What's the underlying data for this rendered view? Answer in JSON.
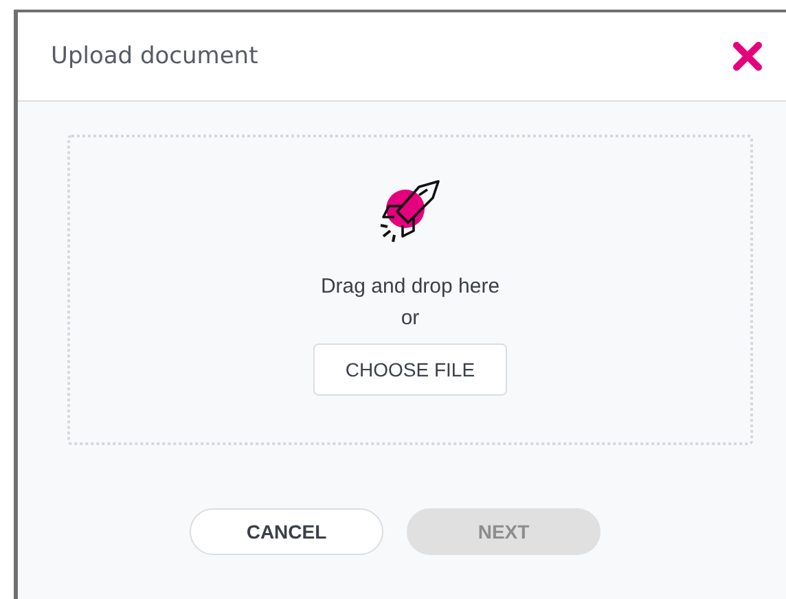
{
  "dialog": {
    "title": "Upload document"
  },
  "dropzone": {
    "prompt": "Drag and drop here",
    "separator": "or",
    "button": "CHOOSE FILE"
  },
  "actions": [
    {
      "label": "CANCEL",
      "disabled": false
    },
    {
      "label": "NEXT",
      "disabled": true
    }
  ]
}
